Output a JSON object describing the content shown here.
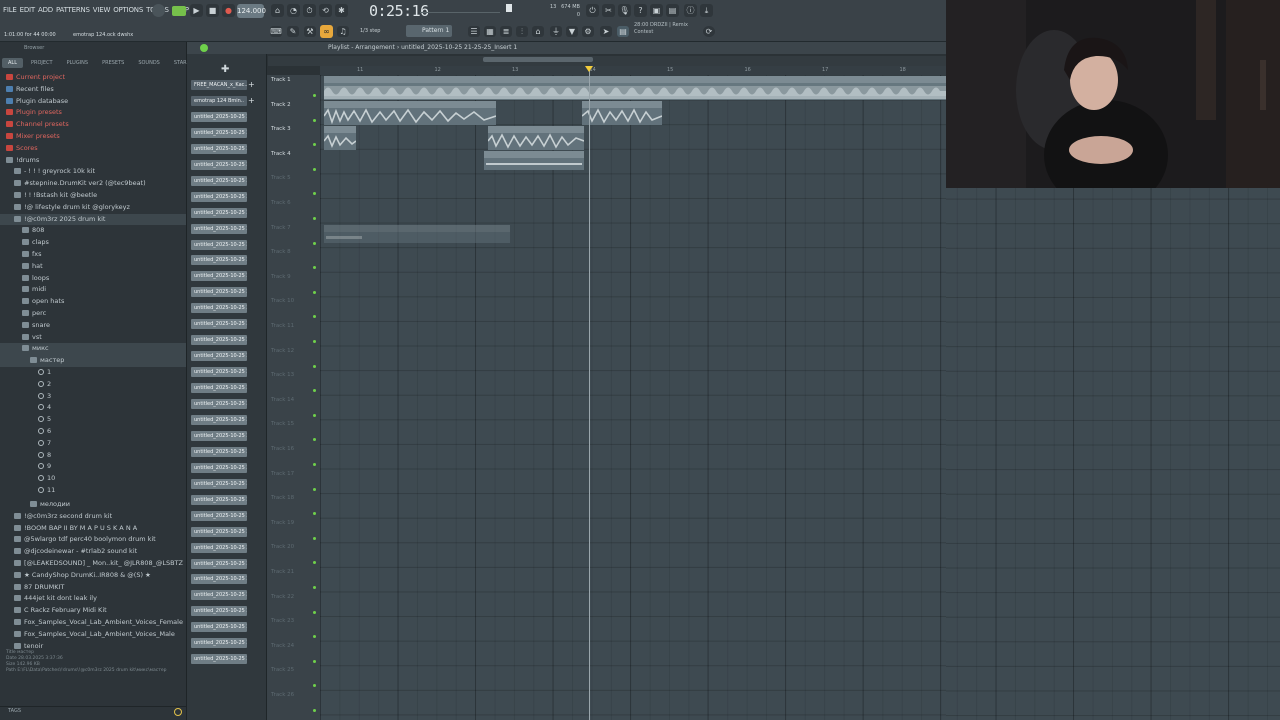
{
  "menu": [
    "FILE",
    "EDIT",
    "ADD",
    "PATTERNS",
    "VIEW",
    "OPTIONS",
    "TOOLS",
    "HELP"
  ],
  "toolbar": {
    "hint_time": "1:01:00 for 44 00:00",
    "hint_file": "emotrap 124.ock dwshx",
    "tempo": "124.000",
    "time": "0:25:16",
    "step": "1/3 step",
    "pattern": "Pattern 1",
    "cpu_top": "13",
    "cpu_mem": "674 MB",
    "cpu_bottom": "0",
    "news_line1": "28:00  DRDZII | Remix",
    "news_line2": "Contest"
  },
  "browser": {
    "title": "Browser",
    "tabs": [
      "ALL",
      "PROJECT",
      "PLUGINS",
      "PRESETS",
      "SOUNDS",
      "STARRED"
    ],
    "items": [
      {
        "label": "Current project",
        "kind": "red",
        "indent": 1
      },
      {
        "label": "Recent files",
        "kind": "blue",
        "indent": 1
      },
      {
        "label": "Plugin database",
        "kind": "blue",
        "indent": 1
      },
      {
        "label": "Plugin presets",
        "kind": "red",
        "indent": 1
      },
      {
        "label": "Channel presets",
        "kind": "red",
        "indent": 1
      },
      {
        "label": "Mixer presets",
        "kind": "red",
        "indent": 1
      },
      {
        "label": "Scores",
        "kind": "red",
        "indent": 1
      },
      {
        "label": "!drums",
        "kind": "folder",
        "indent": 1
      },
      {
        "label": "- ! ! ! greyrock 10k kit",
        "kind": "folder",
        "indent": 2
      },
      {
        "label": "#stepnine.DrumKit ver2 (@tec9beat)",
        "kind": "folder",
        "indent": 2
      },
      {
        "label": "! ! !Bstash kit @beetle",
        "kind": "folder",
        "indent": 2
      },
      {
        "label": "!@ lifestyle drum kit @glorykeyz",
        "kind": "folder",
        "indent": 2
      },
      {
        "label": "!@c0m3rz 2025 drum kit",
        "kind": "folder",
        "indent": 2,
        "sel": true
      },
      {
        "label": "808",
        "kind": "folder",
        "indent": 3
      },
      {
        "label": "claps",
        "kind": "folder",
        "indent": 3
      },
      {
        "label": "fxs",
        "kind": "folder",
        "indent": 3
      },
      {
        "label": "hat",
        "kind": "folder",
        "indent": 3
      },
      {
        "label": "loops",
        "kind": "folder",
        "indent": 3
      },
      {
        "label": "midi",
        "kind": "folder",
        "indent": 3
      },
      {
        "label": "open hats",
        "kind": "folder",
        "indent": 3
      },
      {
        "label": "perc",
        "kind": "folder",
        "indent": 3
      },
      {
        "label": "snare",
        "kind": "folder",
        "indent": 3
      },
      {
        "label": "vst",
        "kind": "folder",
        "indent": 3
      },
      {
        "label": "микс",
        "kind": "folder",
        "indent": 3,
        "sel": true
      },
      {
        "label": "мастер",
        "kind": "folder",
        "indent": 4,
        "sel": true
      },
      {
        "label": "1",
        "kind": "gear",
        "indent": 5
      },
      {
        "label": "2",
        "kind": "gear",
        "indent": 5
      },
      {
        "label": "3",
        "kind": "gear",
        "indent": 5
      },
      {
        "label": "4",
        "kind": "gear",
        "indent": 5
      },
      {
        "label": "5",
        "kind": "gear",
        "indent": 5
      },
      {
        "label": "6",
        "kind": "gear",
        "indent": 5
      },
      {
        "label": "7",
        "kind": "gear",
        "indent": 5
      },
      {
        "label": "8",
        "kind": "gear",
        "indent": 5
      },
      {
        "label": "9",
        "kind": "gear",
        "indent": 5
      },
      {
        "label": "10",
        "kind": "gear",
        "indent": 5
      },
      {
        "label": "11",
        "kind": "gear",
        "indent": 5
      }
    ],
    "items2": [
      {
        "label": "мелодии",
        "kind": "folder",
        "indent": 4
      },
      {
        "label": "!@c0m3rz second drum kit",
        "kind": "folder",
        "indent": 2
      },
      {
        "label": "!BOOM BAP II BY M A P U S K A N A",
        "kind": "folder",
        "indent": 2
      },
      {
        "label": "@5wlargo tdf perc40 boolymon drum kit",
        "kind": "folder",
        "indent": 2
      },
      {
        "label": "@djcodeinewar - #trlab2 sound kit",
        "kind": "folder",
        "indent": 2
      },
      {
        "label": "[@LEAKEDSOUND] _ Mon..kit_ @JLR808_@LSBTZ",
        "kind": "folder",
        "indent": 2
      },
      {
        "label": "★ CandyShop DrumKi..IR808 & @(S) ★",
        "kind": "folder",
        "indent": 2
      },
      {
        "label": "87 DRUMKIT",
        "kind": "folder",
        "indent": 2
      },
      {
        "label": "444jet kit dont leak ily",
        "kind": "folder",
        "indent": 2
      },
      {
        "label": "C Rackz February Midi Kit",
        "kind": "folder",
        "indent": 2
      },
      {
        "label": "Fox_Samples_Vocal_Lab_Ambient_Voices_Female",
        "kind": "folder",
        "indent": 2
      },
      {
        "label": "Fox_Samples_Vocal_Lab_Ambient_Voices_Male",
        "kind": "folder",
        "indent": 2
      },
      {
        "label": "tenoir",
        "kind": "folder",
        "indent": 2
      }
    ],
    "info": {
      "title": "Title     мастер",
      "date": "Date      28.03.2025 3:37:36",
      "size": "Size      142.96 KB",
      "path": "Path      E:\\FL\\Data\\Patches\\!drums\\!@c0m3rz 2025 drum kit\\микс\\мастер"
    },
    "tags": "TAGS"
  },
  "channels": {
    "first": "FREE_MACAN_x_Kac..",
    "second": "emotrap 124 Bmin..",
    "rest": "untitled_2025-10-25 21-"
  },
  "playlist": {
    "title": "Playlist - Arrangement › untitled_2025-10-25 21-25-25_Insert 1",
    "ruler": [
      "11",
      "12",
      "13",
      "14",
      "15",
      "16",
      "17",
      "18"
    ],
    "tracks": [
      "Track 1",
      "Track 2",
      "Track 3",
      "Track 4",
      "Track 5",
      "Track 6",
      "Track 7",
      "Track 8",
      "Track 9",
      "Track 10",
      "Track 11",
      "Track 12",
      "Track 13",
      "Track 14",
      "Track 15",
      "Track 16",
      "Track 17",
      "Track 18",
      "Track 19",
      "Track 20",
      "Track 21",
      "Track 22",
      "Track 23",
      "Track 24",
      "Track 25",
      "Track 26"
    ],
    "clips": {
      "c1": "emotrap 124 Bmin4x8 greyrock dwshx",
      "c2a": "untit.. untitled_2025...23_Ins.. untitled_2025-10-..5-36-41_Insert 1",
      "c2b": "untitled_2025-1...-47_Insert 1",
      "c3a": "untit..ert 1",
      "c3b": "untitled_2025-10-...-23-36-47_Insert 1",
      "c4": "untitled_2025-10-25 21-29-11_Insert 1",
      "c7": "untitled_2025-10-25 21-23-46_Insert 1"
    }
  }
}
